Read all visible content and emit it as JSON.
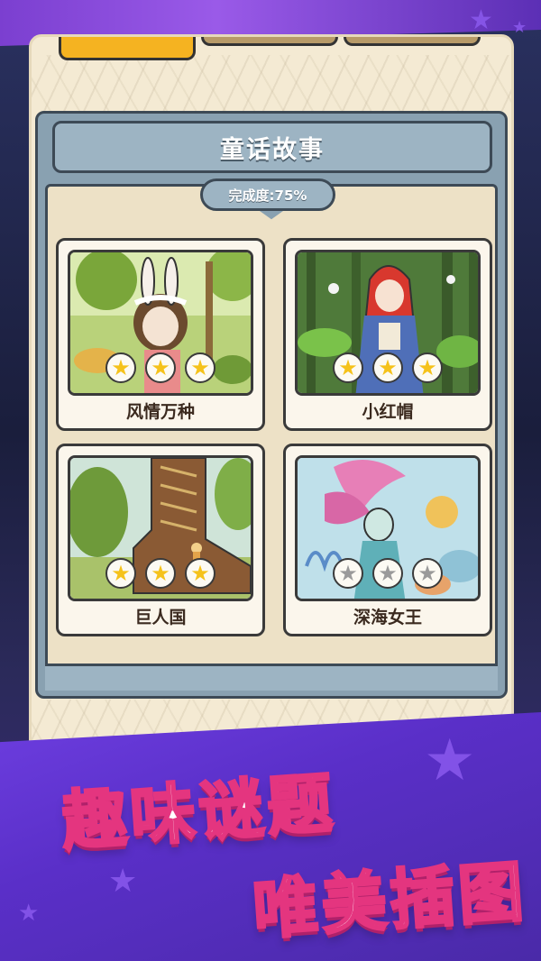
{
  "category": {
    "title": "童话故事",
    "progress_label": "完成度:75%"
  },
  "stories": [
    {
      "name": "风情万种",
      "stars_earned": 3,
      "stars_total": 3,
      "art_icon": "rabbit-girl-illustration"
    },
    {
      "name": "小红帽",
      "stars_earned": 3,
      "stars_total": 3,
      "art_icon": "red-riding-hood-illustration"
    },
    {
      "name": "巨人国",
      "stars_earned": 3,
      "stars_total": 3,
      "art_icon": "giant-boot-illustration"
    },
    {
      "name": "深海女王",
      "stars_earned": 0,
      "stars_total": 3,
      "art_icon": "mermaid-queen-illustration"
    }
  ],
  "promo": {
    "line1": "趣味谜题",
    "line2": "唯美插图"
  },
  "colors": {
    "star_gold": "#f5c21b",
    "star_gray": "#9a9a9a",
    "header_blue": "#9db4c3",
    "promo_pink": "#e4357f",
    "tab_active": "#f5b321"
  }
}
